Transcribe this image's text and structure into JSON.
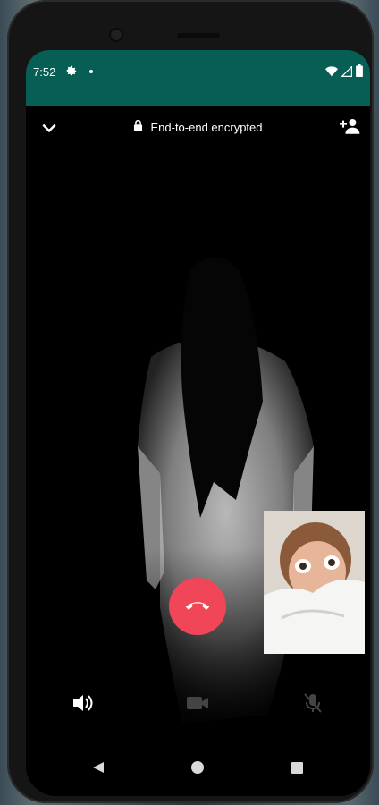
{
  "status_bar": {
    "time": "7:52",
    "left_icons": [
      "settings-icon",
      "notification-dot"
    ],
    "right_icons": [
      "wifi-icon",
      "signal-icon",
      "battery-icon"
    ]
  },
  "header": {
    "minimize_icon": "chevron-down-icon",
    "encryption_label": "End-to-end encrypted",
    "lock_icon": "lock-icon",
    "add_participant_icon": "add-person-icon"
  },
  "call_controls": {
    "end_call_icon": "end-call-icon",
    "speaker_icon": "speaker-icon",
    "video_icon": "video-icon",
    "mute_icon": "mic-off-icon"
  },
  "nav": {
    "back_icon": "back-icon",
    "home_icon": "home-icon",
    "recents_icon": "recents-icon"
  },
  "colors": {
    "status_bar": "#075e54",
    "end_call": "#f04657",
    "screen_bg": "#000000"
  }
}
